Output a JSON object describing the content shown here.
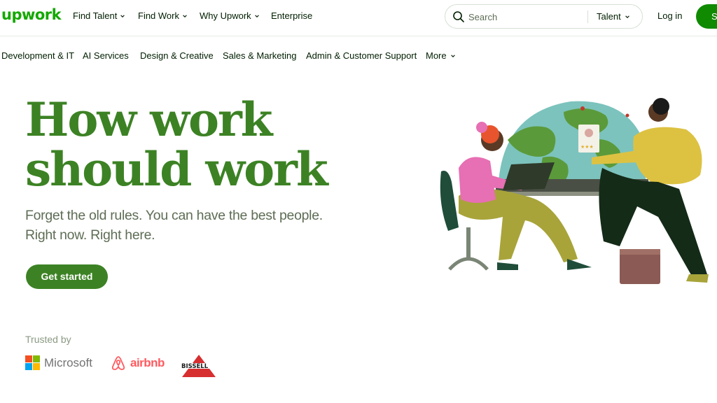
{
  "brand": {
    "logo_text": "upwork",
    "accent": "#14a800",
    "hero_green": "#3c8224"
  },
  "nav": {
    "items": [
      {
        "label": "Find Talent",
        "has_dropdown": true
      },
      {
        "label": "Find Work",
        "has_dropdown": true
      },
      {
        "label": "Why Upwork",
        "has_dropdown": true
      },
      {
        "label": "Enterprise",
        "has_dropdown": false
      }
    ],
    "search_placeholder": "Search",
    "search_scope": "Talent",
    "login_label": "Log in",
    "signup_label": "S"
  },
  "categories": [
    {
      "label": "Development & IT"
    },
    {
      "label": "AI Services"
    },
    {
      "label": "Design & Creative"
    },
    {
      "label": "Sales & Marketing"
    },
    {
      "label": "Admin & Customer Support"
    },
    {
      "label": "More",
      "has_dropdown": true
    }
  ],
  "hero": {
    "title_line1": "How work",
    "title_line2": "should work",
    "subtitle_line1": "Forget the old rules. You can have the best people.",
    "subtitle_line2": "Right now. Right here.",
    "cta_label": "Get started"
  },
  "trusted": {
    "label": "Trusted by",
    "logos": [
      {
        "name": "microsoft-logo",
        "text": "Microsoft"
      },
      {
        "name": "airbnb-logo",
        "text": "airbnb"
      },
      {
        "name": "bissell-logo",
        "text": "BISSELL"
      }
    ]
  }
}
